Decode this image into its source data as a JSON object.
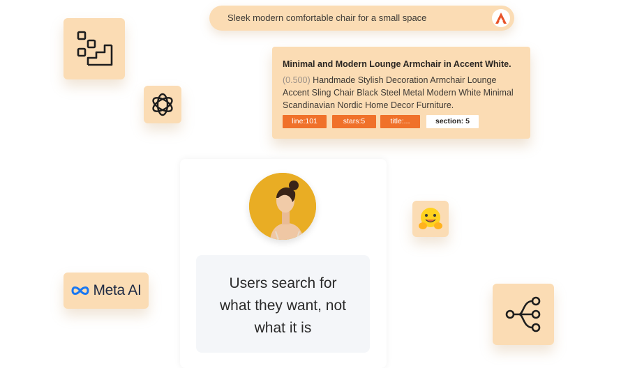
{
  "search": {
    "query": "Sleek modern comfortable chair for a small space",
    "logo_icon": "anthropic-a-icon"
  },
  "result": {
    "title": "Minimal and Modern Lounge Armchair in Accent White.",
    "score": "(0.500)",
    "description": "Handmade Stylish Decoration Armchair Lounge Accent Sling Chair Black Steel Metal Modern White Minimal Scandinavian Nordic Home Decor Furniture.",
    "tags": [
      "line:101",
      "stars:5",
      "title:...",
      "section: 5"
    ]
  },
  "center": {
    "avatar_icon": "user-portrait",
    "line1": "Users search for",
    "line2": "what they want, not",
    "line3": "what it is"
  },
  "tiles": {
    "workflow_icon": "workflow-steps-icon",
    "openai_icon": "openai-icon",
    "huggingface_icon": "hugging-face-icon",
    "meta_label": "Meta AI",
    "meta_icon": "meta-infinity-icon",
    "branch_icon": "branch-tree-icon"
  },
  "colors": {
    "tile": "#fbdcb4",
    "tag": "#f0712a",
    "avatar_bg": "#e9ad24",
    "quote_bg": "#f4f6f9"
  }
}
